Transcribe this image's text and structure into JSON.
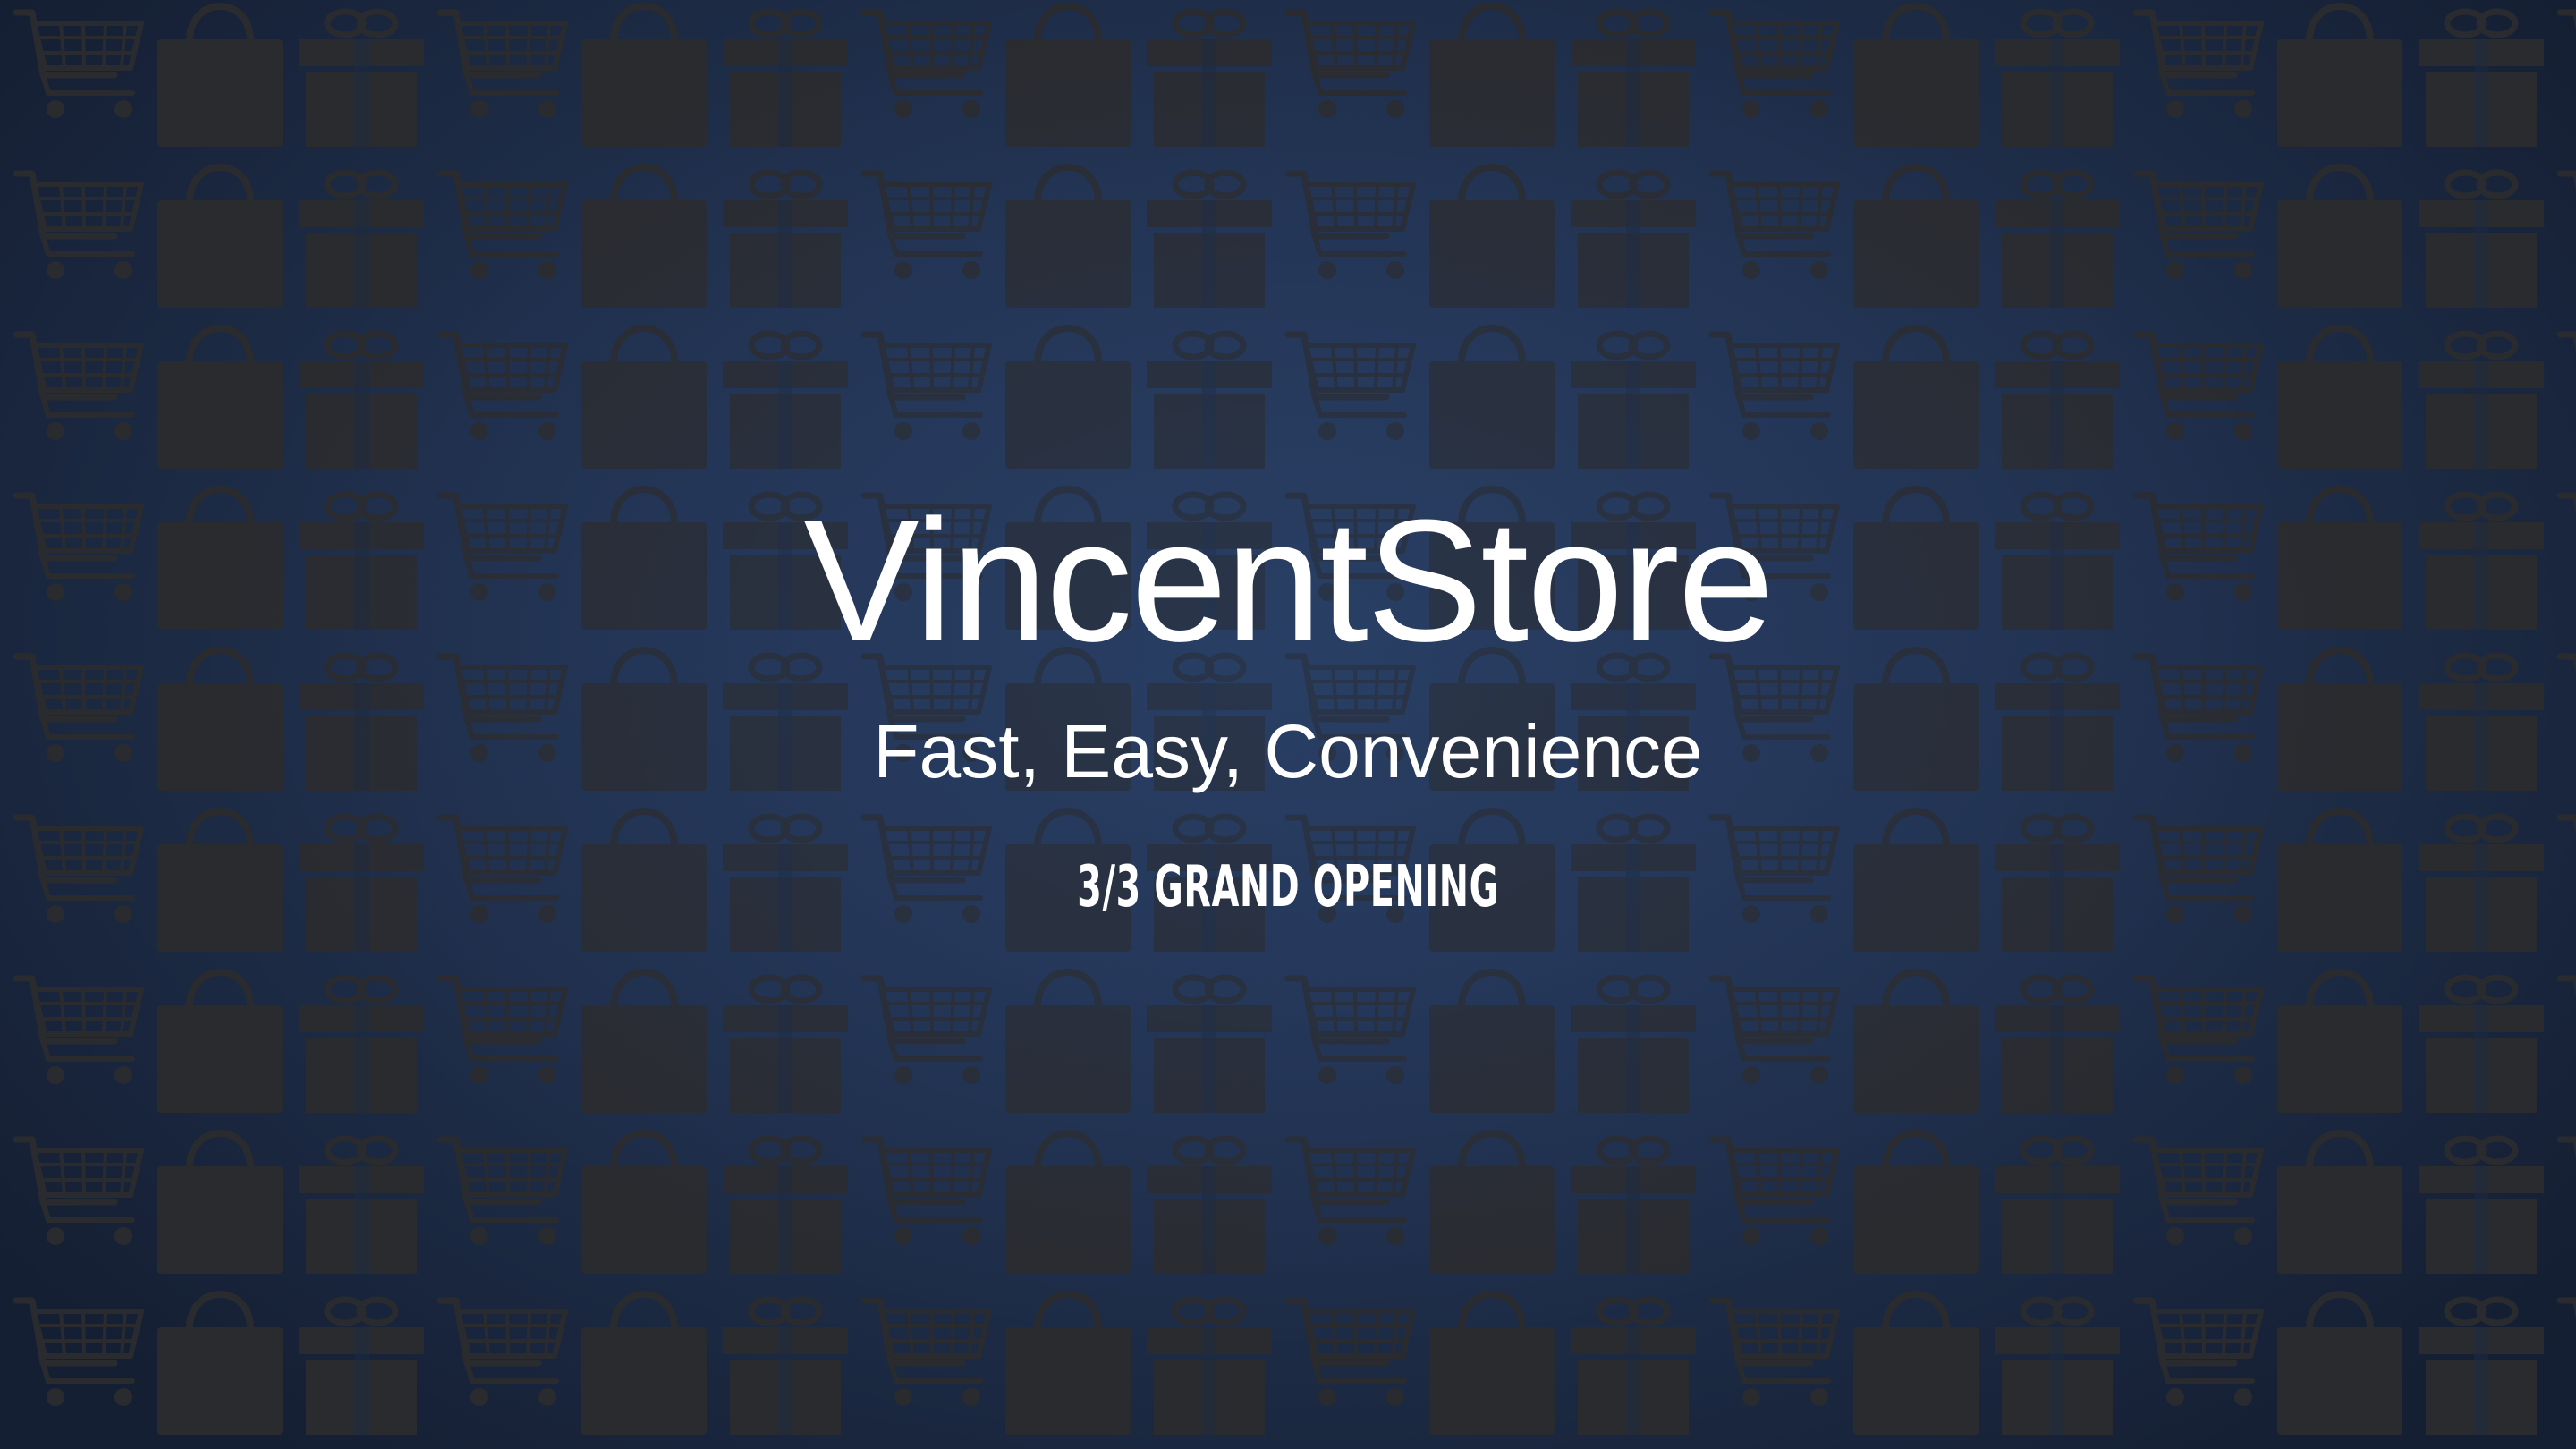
{
  "brand": {
    "name": "VincentStore",
    "tagline": "Fast, Easy, Convenience",
    "event": "3/3 GRAND OPENING"
  },
  "background": {
    "base_color": "#1c2a44",
    "center_color": "#2a3f63",
    "pattern_color": "#2a2b2f",
    "pattern_icons": [
      "shopping-cart-icon",
      "shopping-bag-icon",
      "gift-box-icon"
    ]
  }
}
